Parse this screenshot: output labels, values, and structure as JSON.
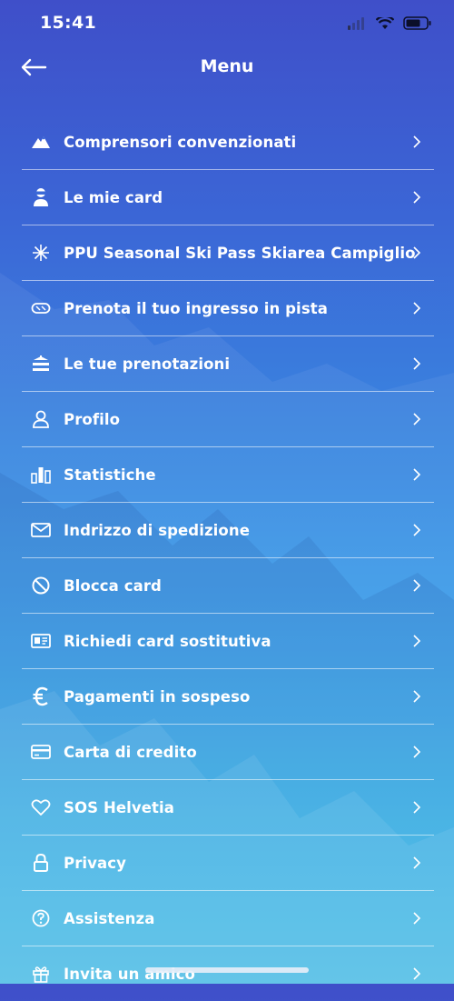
{
  "status": {
    "time": "15:41"
  },
  "header": {
    "title": "Menu"
  },
  "menu": {
    "items": [
      {
        "label": "Comprensori convenzionati",
        "icon": "mountain-icon"
      },
      {
        "label": "Le mie card",
        "icon": "skier-icon"
      },
      {
        "label": "PPU Seasonal Ski Pass Skiarea Campiglio",
        "icon": "sparkle-icon"
      },
      {
        "label": "Prenota il tuo ingresso in pista",
        "icon": "goggles-icon"
      },
      {
        "label": "Le tue prenotazioni",
        "icon": "chairlift-icon"
      },
      {
        "label": "Profilo",
        "icon": "user-icon"
      },
      {
        "label": "Statistiche",
        "icon": "bar-chart-icon"
      },
      {
        "label": "Indrizzo di spedizione",
        "icon": "envelope-icon"
      },
      {
        "label": "Blocca card",
        "icon": "block-icon"
      },
      {
        "label": "Richiedi card sostitutiva",
        "icon": "id-card-icon"
      },
      {
        "label": "Pagamenti in sospeso",
        "icon": "euro-icon"
      },
      {
        "label": "Carta di credito",
        "icon": "credit-card-icon"
      },
      {
        "label": "SOS Helvetia",
        "icon": "heart-icon"
      },
      {
        "label": "Privacy",
        "icon": "lock-icon"
      },
      {
        "label": "Assistenza",
        "icon": "question-icon"
      },
      {
        "label": "Invita un amico",
        "icon": "gift-icon"
      }
    ]
  }
}
